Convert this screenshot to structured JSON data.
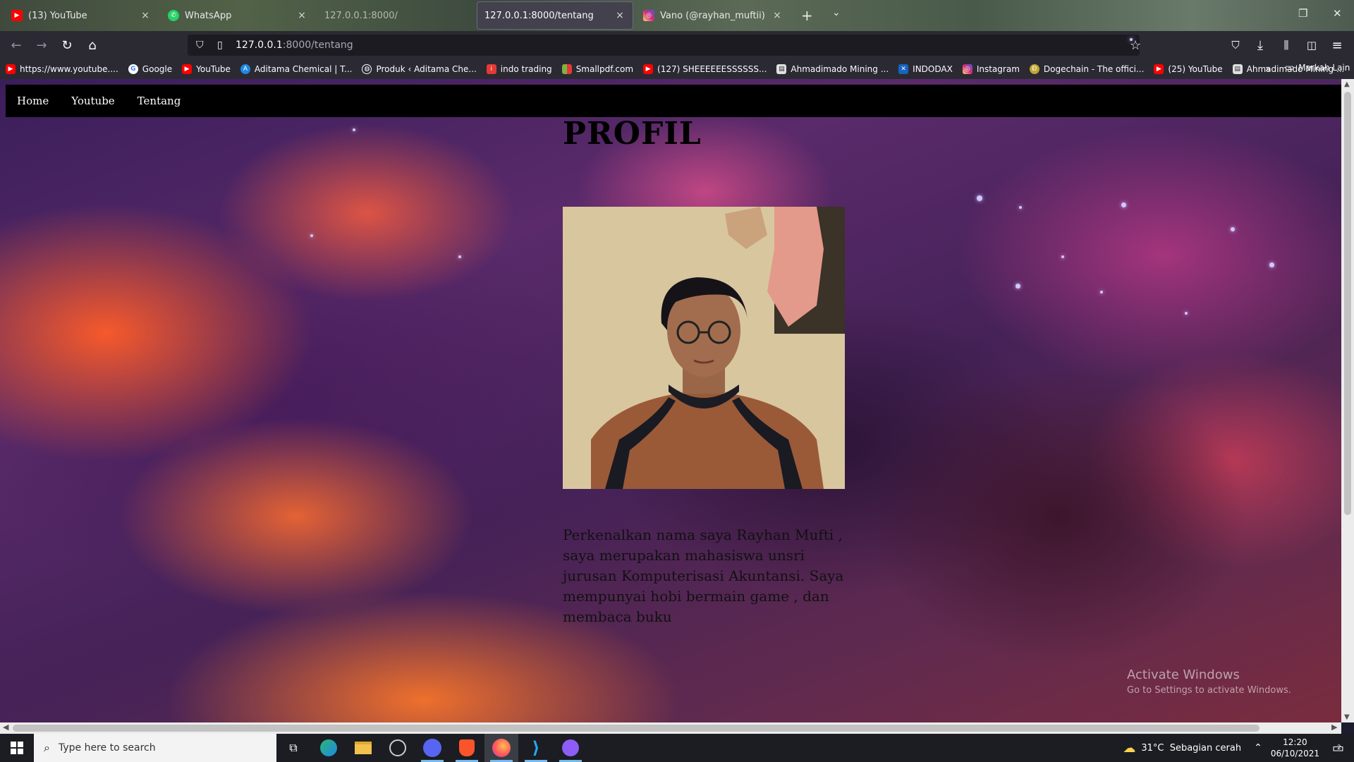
{
  "browser": {
    "tabs": [
      {
        "label": "(13) YouTube",
        "favicon": "youtube-icon",
        "state": "normal",
        "close": "×"
      },
      {
        "label": "WhatsApp",
        "favicon": "whatsapp-icon",
        "state": "normal",
        "close": "×"
      },
      {
        "label": "127.0.0.1:8000/",
        "favicon": "",
        "state": "dim",
        "close": ""
      },
      {
        "label": "127.0.0.1:8000/tentang",
        "favicon": "",
        "state": "active",
        "close": "×"
      },
      {
        "label": "Vano (@rayhan_muftii) • Foto d",
        "favicon": "instagram-icon",
        "state": "normal",
        "close": "×"
      }
    ],
    "new_tab": "+",
    "url": {
      "host": "127.0.0.1",
      "path": ":8000/tentang"
    },
    "bookmarks": [
      {
        "label": "https://www.youtube....",
        "icon": "youtube-icon",
        "color": "#ff0000"
      },
      {
        "label": "Google",
        "icon": "google-icon",
        "color": "#ffffff"
      },
      {
        "label": "YouTube",
        "icon": "youtube-icon",
        "color": "#ff0000"
      },
      {
        "label": "Aditama Chemical | T...",
        "icon": "aditama-icon",
        "color": "#1e88e5"
      },
      {
        "label": "Produk ‹ Aditama Che...",
        "icon": "globe-icon",
        "color": "#2b2a33"
      },
      {
        "label": "indo trading",
        "icon": "indo-trading-icon",
        "color": "#e53935"
      },
      {
        "label": "Smallpdf.com",
        "icon": "smallpdf-icon",
        "color": "#7cb342"
      },
      {
        "label": "(127) SHEEEEEESSSSSS...",
        "icon": "youtube-icon",
        "color": "#ff0000"
      },
      {
        "label": "Ahmadimado Mining ...",
        "icon": "page-icon",
        "color": "#e0e0e0"
      },
      {
        "label": "INDODAX",
        "icon": "indodax-icon",
        "color": "#1565c0"
      },
      {
        "label": "Instagram",
        "icon": "instagram-icon",
        "color": "#d62976"
      },
      {
        "label": "Dogechain - The offici...",
        "icon": "dogechain-icon",
        "color": "#c2a633"
      },
      {
        "label": "(25) YouTube",
        "icon": "youtube-icon",
        "color": "#ff0000"
      },
      {
        "label": "Ahmadimado Mining ...",
        "icon": "page-icon",
        "color": "#e0e0e0"
      }
    ],
    "other_bookmarks": "Markah Lain"
  },
  "site": {
    "nav": [
      "Home",
      "Youtube",
      "Tentang"
    ],
    "heading": "PROFIL",
    "description": "Perkenalkan nama saya Rayhan Mufti , saya merupakan mahasiswa unsri jurusan Komputerisasi Akuntansi. Saya mempunyai hobi bermain game , dan membaca buku"
  },
  "watermark": {
    "title": "Activate Windows",
    "subtitle": "Go to Settings to activate Windows."
  },
  "taskbar": {
    "search_placeholder": "Type here to search",
    "weather": "31°C  Sebagian cerah",
    "time": "12:20",
    "date": "06/10/2021",
    "notification_count": "2"
  }
}
